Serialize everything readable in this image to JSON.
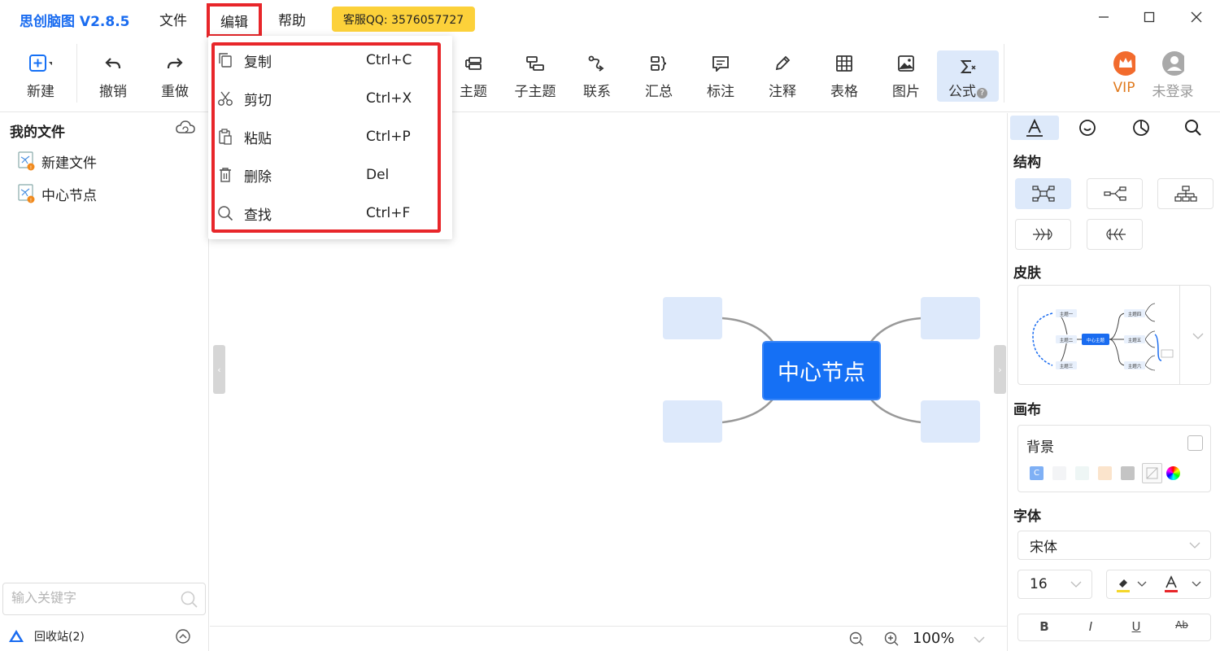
{
  "app": {
    "title": "思创脑图 V2.8.5"
  },
  "menubar": {
    "file": "文件",
    "edit": "编辑",
    "help": "帮助",
    "support": "客服QQ: 3576057727"
  },
  "toolbar": {
    "new": "新建",
    "undo": "撤销",
    "redo": "重做",
    "topic": "主题",
    "subtopic": "子主题",
    "relation": "联系",
    "summary": "汇总",
    "label": "标注",
    "note": "注释",
    "table": "表格",
    "image": "图片",
    "formula": "公式",
    "vip": "VIP",
    "login": "未登录"
  },
  "edit_menu": [
    {
      "label": "复制",
      "shortcut": "Ctrl+C",
      "icon": "copy-icon"
    },
    {
      "label": "剪切",
      "shortcut": "Ctrl+X",
      "icon": "scissors-icon"
    },
    {
      "label": "粘贴",
      "shortcut": "Ctrl+P",
      "icon": "paste-icon"
    },
    {
      "label": "删除",
      "shortcut": "Del",
      "icon": "trash-icon"
    },
    {
      "label": "查找",
      "shortcut": "Ctrl+F",
      "icon": "search-icon"
    }
  ],
  "sidebar": {
    "title": "我的文件",
    "files": [
      "新建文件",
      "中心节点"
    ],
    "search_placeholder": "输入关键字",
    "recycle": "回收站(2)"
  },
  "canvas": {
    "center_node": "中心节点",
    "zoom": "100%"
  },
  "right_panel": {
    "structure": "结构",
    "skin": "皮肤",
    "canvas": "画布",
    "background": "背景",
    "font": "字体",
    "font_family": "宋体",
    "font_size": "16",
    "bold": "B",
    "italic": "I",
    "underline": "U",
    "strike": "Ab",
    "preview": {
      "center": "中心主题",
      "topics": [
        "主题一",
        "主题二",
        "主题三",
        "主题四",
        "主题五",
        "主题六"
      ]
    }
  },
  "colors": {
    "accent": "#1570f5",
    "highlight_frame": "#e8262a",
    "support_badge": "#fcd13a",
    "node_fill": "#dde9fb"
  }
}
